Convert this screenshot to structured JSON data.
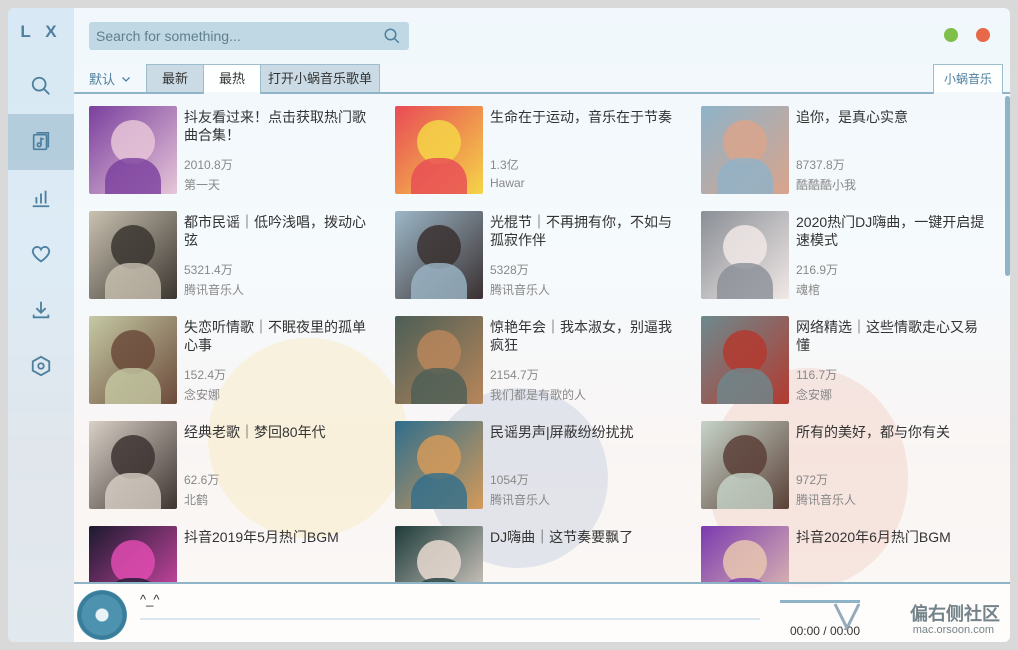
{
  "app": {
    "logo": "L X"
  },
  "sidebar": {
    "items": [
      {
        "name": "search",
        "icon": "search-icon"
      },
      {
        "name": "songlist",
        "icon": "music-list-icon",
        "active": true
      },
      {
        "name": "leaderboard",
        "icon": "bar-chart-icon"
      },
      {
        "name": "favorites",
        "icon": "heart-icon"
      },
      {
        "name": "download",
        "icon": "download-icon"
      },
      {
        "name": "settings",
        "icon": "settings-icon"
      }
    ]
  },
  "search": {
    "placeholder": "Search for something..."
  },
  "window_controls": {
    "minimize_color": "#7fc04a",
    "close_color": "#e8684a"
  },
  "tabs": {
    "sort_label": "默认",
    "items": [
      {
        "label": "最新"
      },
      {
        "label": "最热",
        "active": true
      },
      {
        "label": "打开小蜗音乐歌单"
      }
    ],
    "source": "小蜗音乐"
  },
  "playlists": [
    {
      "title": "抖友看过来！点击获取热门歌曲合集！",
      "count": "2010.8万",
      "author": "第一天",
      "colors": [
        "#7a3f9e",
        "#e7c6d8"
      ]
    },
    {
      "title": "生命在于运动，音乐在于节奏",
      "count": "1.3亿",
      "author": "Hawar",
      "colors": [
        "#e94a56",
        "#f5d547"
      ]
    },
    {
      "title": "追你，是真心实意",
      "count": "8737.8万",
      "author": "酷酷酷小我",
      "colors": [
        "#8eb3c9",
        "#d9a48c"
      ]
    },
    {
      "title": "都市民谣｜低吟浅唱，拨动心弦",
      "count": "5321.4万",
      "author": "腾讯音乐人",
      "colors": [
        "#c9c2b1",
        "#3b3530"
      ]
    },
    {
      "title": "光棍节｜不再拥有你，不如与孤寂作伴",
      "count": "5328万",
      "author": "腾讯音乐人",
      "colors": [
        "#9cb7c8",
        "#3a3030"
      ]
    },
    {
      "title": "2020热门DJ嗨曲，一键开启提速模式",
      "count": "216.9万",
      "author": "魂棺",
      "colors": [
        "#8a8f96",
        "#f0e8e6"
      ]
    },
    {
      "title": "失恋听情歌｜不眠夜里的孤单心事",
      "count": "152.4万",
      "author": "念安娜",
      "colors": [
        "#c5c9a4",
        "#6b4a3a"
      ]
    },
    {
      "title": "惊艳年会｜我本淑女，别逼我疯狂",
      "count": "2154.7万",
      "author": "我们都是有歌的人",
      "colors": [
        "#4b5e56",
        "#b8865a"
      ]
    },
    {
      "title": "网络精选｜这些情歌走心又易懂",
      "count": "116.7万",
      "author": "念安娜",
      "colors": [
        "#6d8a8e",
        "#b3392f"
      ]
    },
    {
      "title": "经典老歌｜梦回80年代",
      "count": "62.6万",
      "author": "北鹤",
      "colors": [
        "#d8cfc6",
        "#3d3431"
      ]
    },
    {
      "title": "民谣男声|屏蔽纷纷扰扰",
      "count": "1054万",
      "author": "腾讯音乐人",
      "colors": [
        "#2f6e8c",
        "#d49a5a"
      ]
    },
    {
      "title": "所有的美好，都与你有关",
      "count": "972万",
      "author": "腾讯音乐人",
      "colors": [
        "#c7d4c9",
        "#5a4037"
      ]
    },
    {
      "title": "抖音2019年5月热门BGM",
      "count": "",
      "author": "",
      "colors": [
        "#1b1a2e",
        "#e04bb0"
      ]
    },
    {
      "title": "DJ嗨曲｜这节奏要飘了",
      "count": "",
      "author": "",
      "colors": [
        "#1d3b3a",
        "#e7d9d0"
      ]
    },
    {
      "title": "抖音2020年6月热门BGM",
      "count": "",
      "author": "",
      "colors": [
        "#7b3ab0",
        "#e8c6b0"
      ]
    }
  ],
  "player": {
    "title": "^_^",
    "time": "00:00 / 00:00",
    "progress": 0
  },
  "watermark": {
    "text": "偏右侧社区",
    "url": "mac.orsoon.com"
  }
}
